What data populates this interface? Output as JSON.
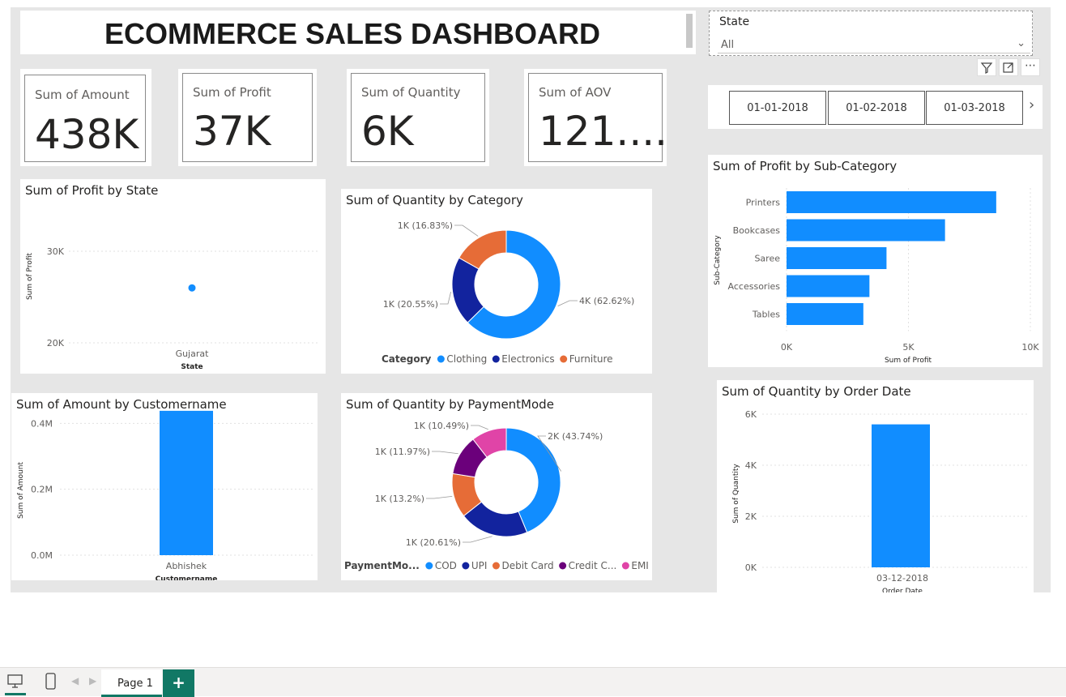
{
  "title": "ECOMMERCE SALES DASHBOARD",
  "slicer": {
    "label": "State",
    "value": "All"
  },
  "kpis": [
    {
      "label": "Sum of Amount",
      "value": "438K"
    },
    {
      "label": "Sum of Profit",
      "value": "37K"
    },
    {
      "label": "Sum of Quantity",
      "value": "6K"
    },
    {
      "label": "Sum of AOV",
      "value": "121...."
    }
  ],
  "dates": [
    "01-01-2018",
    "01-02-2018",
    "01-03-2018"
  ],
  "colors": {
    "blue": "#118dff",
    "navy": "#12239e",
    "orange": "#e66c37",
    "purple": "#6b007b",
    "pink": "#e044a7",
    "green": "#117865"
  },
  "chart_data": [
    {
      "type": "scatter",
      "title": "Sum of Profit by State",
      "xlabel": "State",
      "ylabel": "Sum of Profit",
      "categories": [
        "Gujarat"
      ],
      "values": [
        26000
      ],
      "yticks": [
        "30K",
        "20K"
      ],
      "ylim": [
        20000,
        30000
      ]
    },
    {
      "type": "pie",
      "title": "Sum of Quantity by Category",
      "legend_title": "Category",
      "slices": [
        {
          "name": "Clothing",
          "label": "4K (62.62%)",
          "pct": 62.62,
          "color": "#118dff"
        },
        {
          "name": "Electronics",
          "label": "1K (20.55%)",
          "pct": 20.55,
          "color": "#12239e"
        },
        {
          "name": "Furniture",
          "label": "1K (16.83%)",
          "pct": 16.83,
          "color": "#e66c37"
        }
      ]
    },
    {
      "type": "bar",
      "title": "Sum of Profit by Sub-Category",
      "xlabel": "Sum of Profit",
      "ylabel": "Sub-Category",
      "categories": [
        "Printers",
        "Bookcases",
        "Saree",
        "Accessories",
        "Tables"
      ],
      "values": [
        8600,
        6500,
        4100,
        3400,
        3150
      ],
      "xticks": [
        "0K",
        "5K",
        "10K"
      ],
      "xlim": [
        0,
        10000
      ]
    },
    {
      "type": "bar",
      "title": "Sum of Amount by Customername",
      "xlabel": "Customername",
      "ylabel": "Sum of Amount",
      "categories": [
        "Abhishek"
      ],
      "values": [
        438000
      ],
      "yticks": [
        "0.4M",
        "0.2M",
        "0.0M"
      ],
      "ylim": [
        0,
        450000
      ]
    },
    {
      "type": "pie",
      "title": "Sum of Quantity by PaymentMode",
      "legend_title": "PaymentMo...",
      "slices": [
        {
          "name": "COD",
          "label": "2K (43.74%)",
          "pct": 43.74,
          "color": "#118dff"
        },
        {
          "name": "UPI",
          "label": "1K (20.61%)",
          "pct": 20.61,
          "color": "#12239e"
        },
        {
          "name": "Debit Card",
          "label": "1K (13.2%)",
          "pct": 13.2,
          "color": "#e66c37"
        },
        {
          "name": "Credit C...",
          "label": "1K (11.97%)",
          "pct": 11.97,
          "color": "#6b007b"
        },
        {
          "name": "EMI",
          "label": "1K (10.49%)",
          "pct": 10.49,
          "color": "#e044a7"
        }
      ]
    },
    {
      "type": "bar",
      "title": "Sum of Quantity by Order Date",
      "xlabel": "Order Date",
      "ylabel": "Sum of Quantity",
      "categories": [
        "03-12-2018"
      ],
      "values": [
        5600
      ],
      "yticks": [
        "6K",
        "4K",
        "2K",
        "0K"
      ],
      "ylim": [
        0,
        6000
      ]
    }
  ],
  "statusbar": {
    "page": "Page 1",
    "add": "+"
  }
}
